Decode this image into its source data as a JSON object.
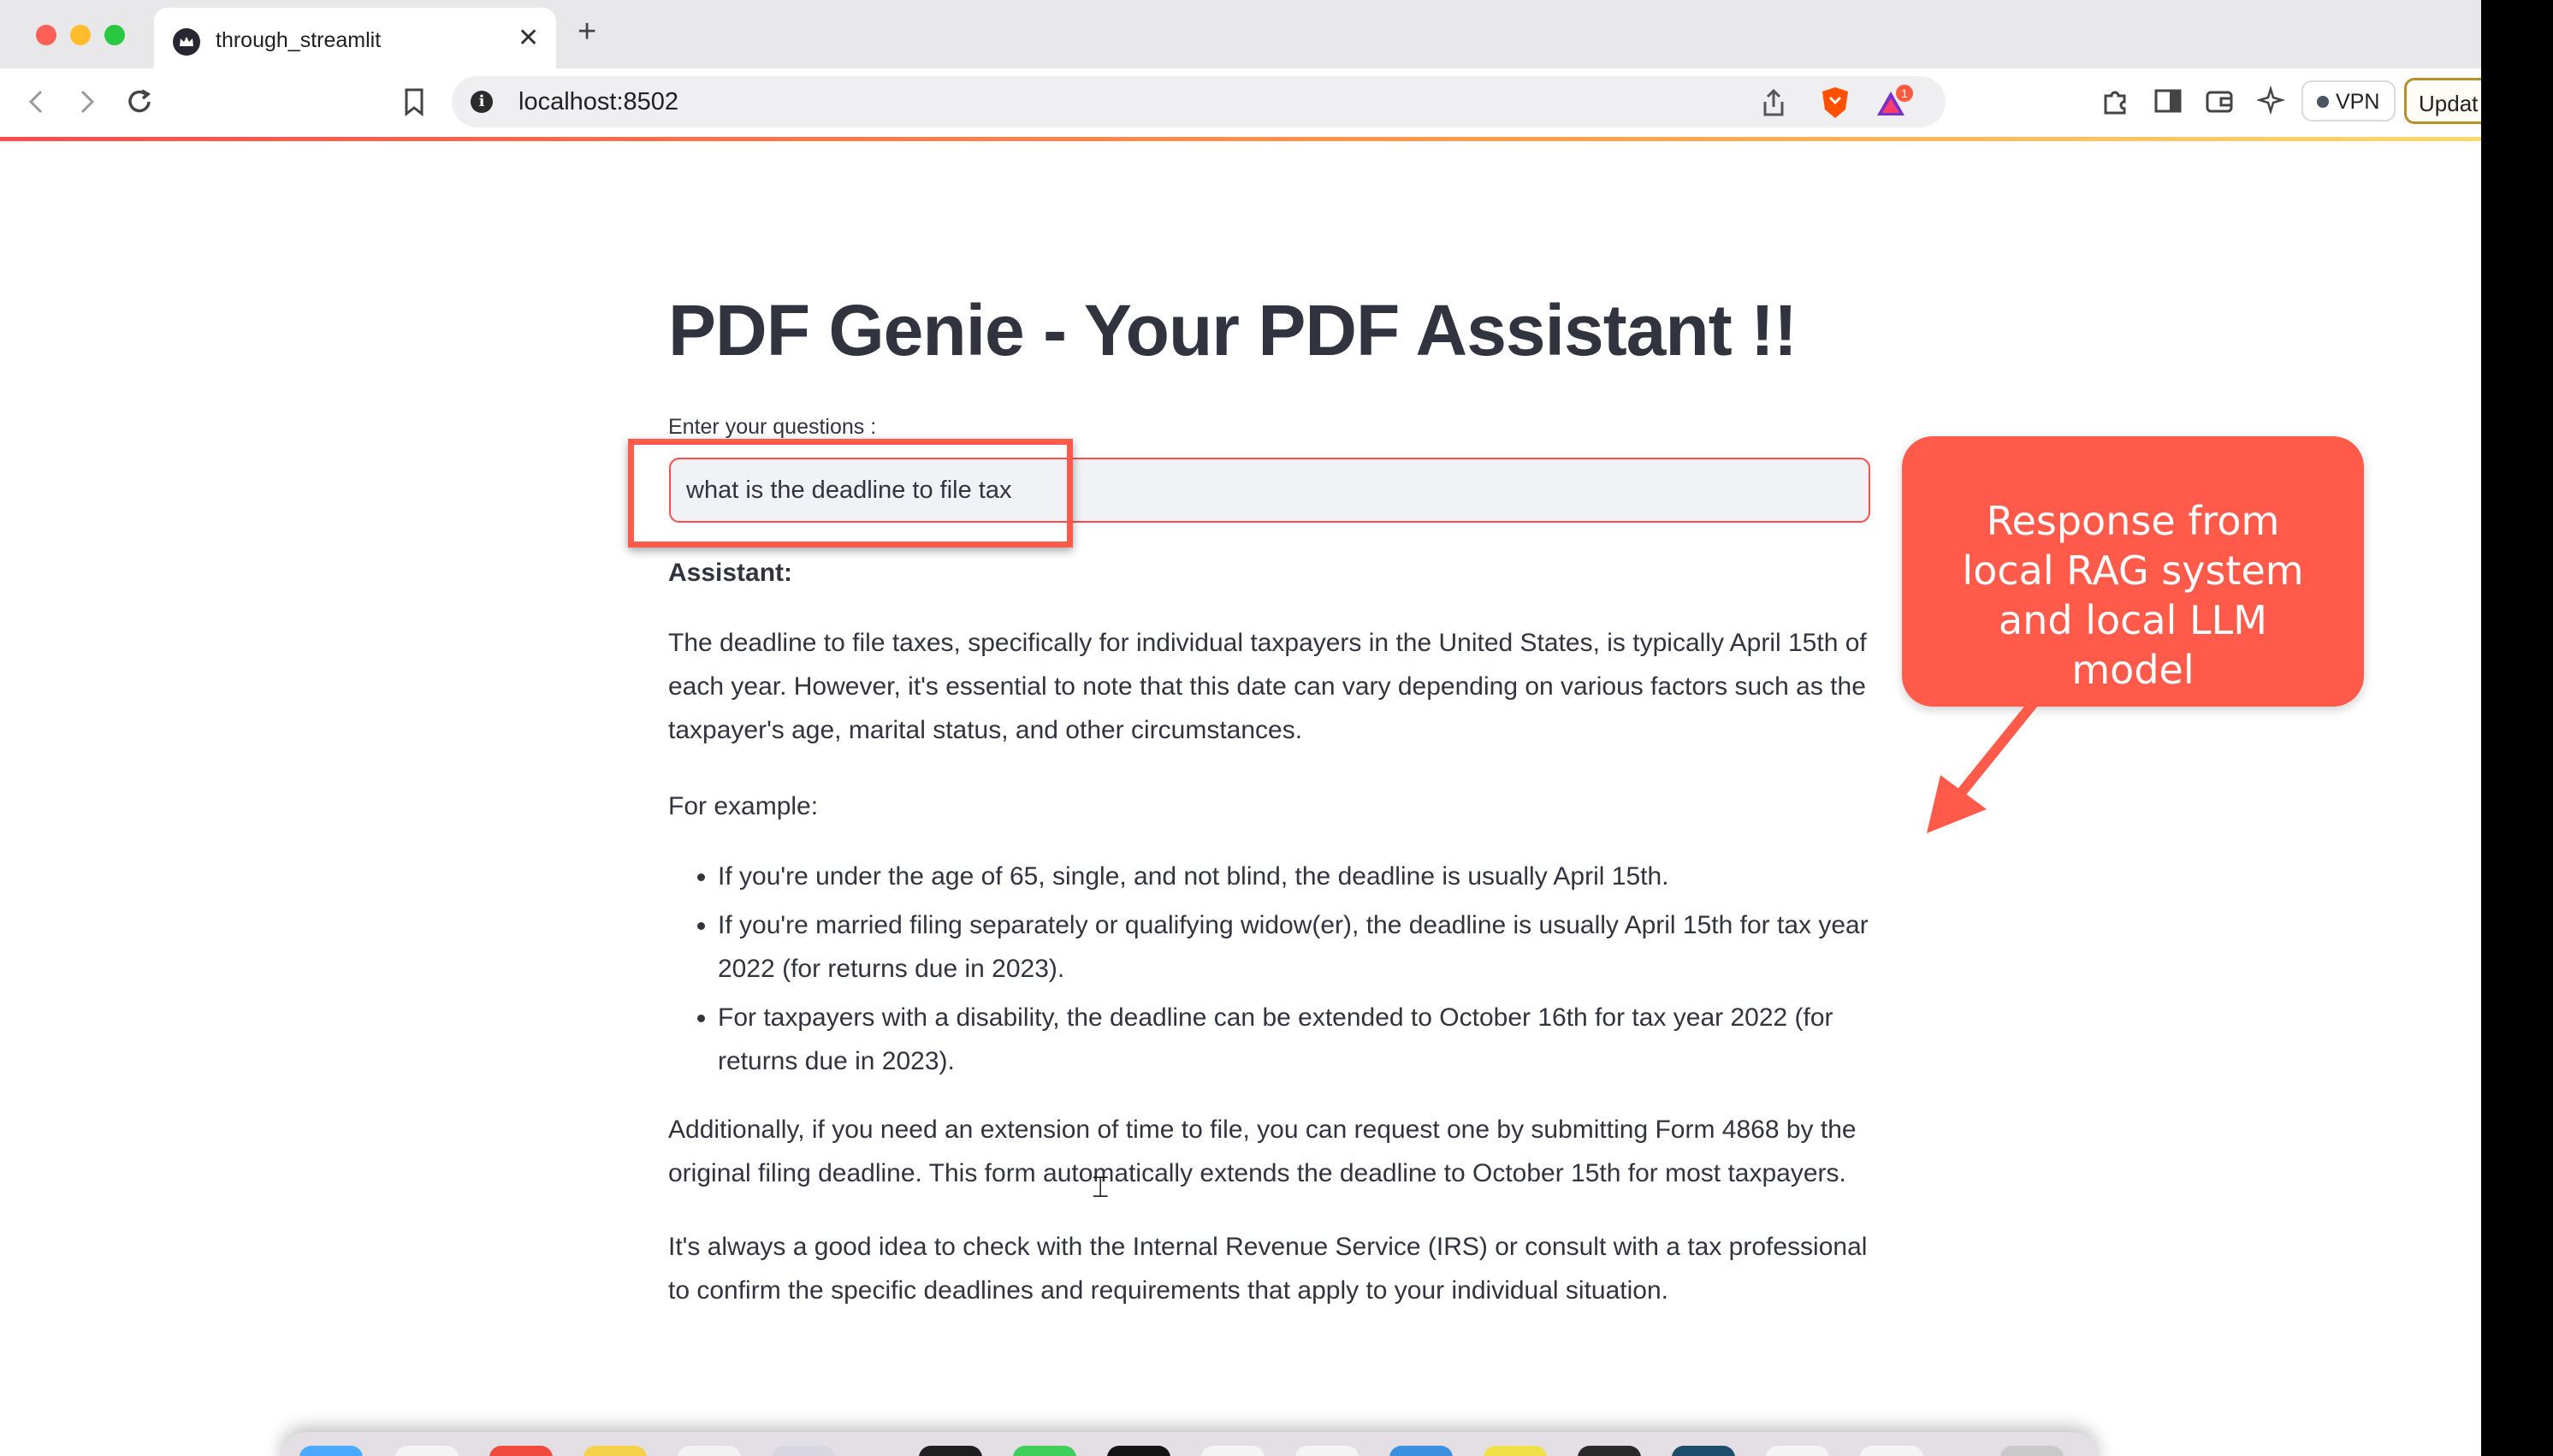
{
  "browser": {
    "tab_title": "through_streamlit",
    "tab_close": "✕",
    "new_tab": "+",
    "url": "localhost:8502",
    "info_glyph": "i",
    "vpn_label": "VPN",
    "update_label": "Updat",
    "notification_count": "1",
    "accent_gradient": [
      "#ff4b4b",
      "#ff9b4b",
      "#ffd86b"
    ]
  },
  "page": {
    "title": "PDF Genie - Your PDF Assistant !!",
    "input_label": "Enter your questions :",
    "input_value": "what is the deadline to file tax",
    "assistant_label": "Assistant:",
    "paragraphs": [
      "The deadline to file taxes, specifically for individual taxpayers in the United States, is typically April 15th of each year. However, it's essential to note that this date can vary depending on various factors such as the taxpayer's age, marital status, and other circumstances.",
      "For example:",
      "Additionally, if you need an extension of time to file, you can request one by submitting Form 4868 by the original filing deadline. This form automatically extends the deadline to October 15th for most taxpayers.",
      "It's always a good idea to check with the Internal Revenue Service (IRS) or consult with a tax professional to confirm the specific deadlines and requirements that apply to your individual situation."
    ],
    "bullets": [
      "If you're under the age of 65, single, and not blind, the deadline is usually April 15th.",
      "If you're married filing separately or qualifying widow(er), the deadline is usually April 15th for tax year 2022 (for returns due in 2023).",
      "For taxpayers with a disability, the deadline can be extended to October 16th for tax year 2022 (for returns due in 2023)."
    ],
    "text_color": "#31333f",
    "input_border_color": "#ff4b4b"
  },
  "annotation": {
    "callout_text": "Response from local RAG system and local LLM model",
    "color": "#ff5a4a"
  },
  "icons": [
    "streamlit-crown-icon",
    "back-icon",
    "forward-icon",
    "reload-icon",
    "bookmark-icon",
    "share-icon",
    "brave-shield-icon",
    "rewards-icon",
    "extensions-icon",
    "sidebar-icon",
    "wallet-icon",
    "leo-ai-icon"
  ]
}
